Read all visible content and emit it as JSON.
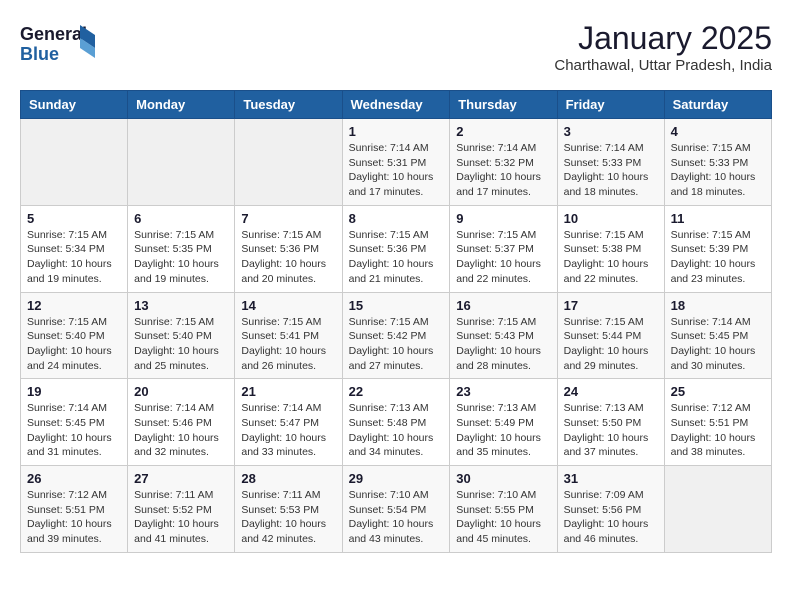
{
  "header": {
    "logo_line1": "General",
    "logo_line2": "Blue",
    "title": "January 2025",
    "location": "Charthawal, Uttar Pradesh, India"
  },
  "days_of_week": [
    "Sunday",
    "Monday",
    "Tuesday",
    "Wednesday",
    "Thursday",
    "Friday",
    "Saturday"
  ],
  "weeks": [
    [
      {
        "day": "",
        "info": ""
      },
      {
        "day": "",
        "info": ""
      },
      {
        "day": "",
        "info": ""
      },
      {
        "day": "1",
        "info": "Sunrise: 7:14 AM\nSunset: 5:31 PM\nDaylight: 10 hours and 17 minutes."
      },
      {
        "day": "2",
        "info": "Sunrise: 7:14 AM\nSunset: 5:32 PM\nDaylight: 10 hours and 17 minutes."
      },
      {
        "day": "3",
        "info": "Sunrise: 7:14 AM\nSunset: 5:33 PM\nDaylight: 10 hours and 18 minutes."
      },
      {
        "day": "4",
        "info": "Sunrise: 7:15 AM\nSunset: 5:33 PM\nDaylight: 10 hours and 18 minutes."
      }
    ],
    [
      {
        "day": "5",
        "info": "Sunrise: 7:15 AM\nSunset: 5:34 PM\nDaylight: 10 hours and 19 minutes."
      },
      {
        "day": "6",
        "info": "Sunrise: 7:15 AM\nSunset: 5:35 PM\nDaylight: 10 hours and 19 minutes."
      },
      {
        "day": "7",
        "info": "Sunrise: 7:15 AM\nSunset: 5:36 PM\nDaylight: 10 hours and 20 minutes."
      },
      {
        "day": "8",
        "info": "Sunrise: 7:15 AM\nSunset: 5:36 PM\nDaylight: 10 hours and 21 minutes."
      },
      {
        "day": "9",
        "info": "Sunrise: 7:15 AM\nSunset: 5:37 PM\nDaylight: 10 hours and 22 minutes."
      },
      {
        "day": "10",
        "info": "Sunrise: 7:15 AM\nSunset: 5:38 PM\nDaylight: 10 hours and 22 minutes."
      },
      {
        "day": "11",
        "info": "Sunrise: 7:15 AM\nSunset: 5:39 PM\nDaylight: 10 hours and 23 minutes."
      }
    ],
    [
      {
        "day": "12",
        "info": "Sunrise: 7:15 AM\nSunset: 5:40 PM\nDaylight: 10 hours and 24 minutes."
      },
      {
        "day": "13",
        "info": "Sunrise: 7:15 AM\nSunset: 5:40 PM\nDaylight: 10 hours and 25 minutes."
      },
      {
        "day": "14",
        "info": "Sunrise: 7:15 AM\nSunset: 5:41 PM\nDaylight: 10 hours and 26 minutes."
      },
      {
        "day": "15",
        "info": "Sunrise: 7:15 AM\nSunset: 5:42 PM\nDaylight: 10 hours and 27 minutes."
      },
      {
        "day": "16",
        "info": "Sunrise: 7:15 AM\nSunset: 5:43 PM\nDaylight: 10 hours and 28 minutes."
      },
      {
        "day": "17",
        "info": "Sunrise: 7:15 AM\nSunset: 5:44 PM\nDaylight: 10 hours and 29 minutes."
      },
      {
        "day": "18",
        "info": "Sunrise: 7:14 AM\nSunset: 5:45 PM\nDaylight: 10 hours and 30 minutes."
      }
    ],
    [
      {
        "day": "19",
        "info": "Sunrise: 7:14 AM\nSunset: 5:45 PM\nDaylight: 10 hours and 31 minutes."
      },
      {
        "day": "20",
        "info": "Sunrise: 7:14 AM\nSunset: 5:46 PM\nDaylight: 10 hours and 32 minutes."
      },
      {
        "day": "21",
        "info": "Sunrise: 7:14 AM\nSunset: 5:47 PM\nDaylight: 10 hours and 33 minutes."
      },
      {
        "day": "22",
        "info": "Sunrise: 7:13 AM\nSunset: 5:48 PM\nDaylight: 10 hours and 34 minutes."
      },
      {
        "day": "23",
        "info": "Sunrise: 7:13 AM\nSunset: 5:49 PM\nDaylight: 10 hours and 35 minutes."
      },
      {
        "day": "24",
        "info": "Sunrise: 7:13 AM\nSunset: 5:50 PM\nDaylight: 10 hours and 37 minutes."
      },
      {
        "day": "25",
        "info": "Sunrise: 7:12 AM\nSunset: 5:51 PM\nDaylight: 10 hours and 38 minutes."
      }
    ],
    [
      {
        "day": "26",
        "info": "Sunrise: 7:12 AM\nSunset: 5:51 PM\nDaylight: 10 hours and 39 minutes."
      },
      {
        "day": "27",
        "info": "Sunrise: 7:11 AM\nSunset: 5:52 PM\nDaylight: 10 hours and 41 minutes."
      },
      {
        "day": "28",
        "info": "Sunrise: 7:11 AM\nSunset: 5:53 PM\nDaylight: 10 hours and 42 minutes."
      },
      {
        "day": "29",
        "info": "Sunrise: 7:10 AM\nSunset: 5:54 PM\nDaylight: 10 hours and 43 minutes."
      },
      {
        "day": "30",
        "info": "Sunrise: 7:10 AM\nSunset: 5:55 PM\nDaylight: 10 hours and 45 minutes."
      },
      {
        "day": "31",
        "info": "Sunrise: 7:09 AM\nSunset: 5:56 PM\nDaylight: 10 hours and 46 minutes."
      },
      {
        "day": "",
        "info": ""
      }
    ]
  ]
}
